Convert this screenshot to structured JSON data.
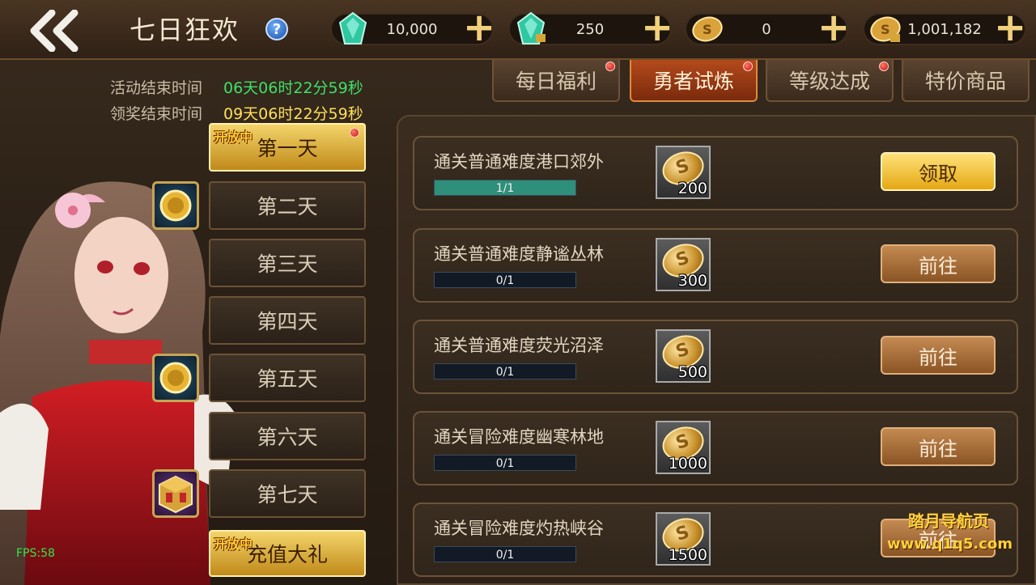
{
  "header": {
    "title": "七日狂欢",
    "help_symbol": "?",
    "back_symbol": "<<"
  },
  "resources": [
    {
      "icon": "green-gem-icon",
      "value": "10,000"
    },
    {
      "icon": "locked-gem-icon",
      "value": "250"
    },
    {
      "icon": "gold-coin-icon",
      "value": "0"
    },
    {
      "icon": "locked-coin-icon",
      "value": "1,001,182"
    }
  ],
  "plus_symbol": "+",
  "tabs": [
    {
      "label": "每日福利",
      "badge": true
    },
    {
      "label": "勇者试炼",
      "badge": true,
      "active": true
    },
    {
      "label": "等级达成",
      "badge": true
    },
    {
      "label": "特价商品",
      "badge": false
    }
  ],
  "timers": {
    "event_end_label": "活动结束时间",
    "event_end_value": "06天06时22分59秒",
    "claim_end_label": "领奖结束时间",
    "claim_end_value": "09天06时22分59秒"
  },
  "days": [
    {
      "label": "第一天",
      "open_tag": "开放中",
      "active": true
    },
    {
      "label": "第二天"
    },
    {
      "label": "第三天"
    },
    {
      "label": "第四天"
    },
    {
      "label": "第五天"
    },
    {
      "label": "第六天"
    },
    {
      "label": "第七天"
    },
    {
      "label": "充值大礼",
      "open_tag": "开放中",
      "active": true
    }
  ],
  "tasks": [
    {
      "title": "通关普通难度港口郊外",
      "progress": "1/1",
      "fraction": 1.0,
      "reward": "200",
      "button": "领取",
      "claimable": true
    },
    {
      "title": "通关普通难度静谧丛林",
      "progress": "0/1",
      "fraction": 0,
      "reward": "300",
      "button": "前往",
      "claimable": false
    },
    {
      "title": "通关普通难度荧光沼泽",
      "progress": "0/1",
      "fraction": 0,
      "reward": "500",
      "button": "前往",
      "claimable": false
    },
    {
      "title": "通关冒险难度幽寒林地",
      "progress": "0/1",
      "fraction": 0,
      "reward": "1000",
      "button": "前往",
      "claimable": false
    },
    {
      "title": "通关冒险难度灼热峡谷",
      "progress": "0/1",
      "fraction": 0,
      "reward": "1500",
      "button": "前往",
      "claimable": false
    }
  ],
  "fps": "FPS:58",
  "watermark": {
    "line1": "踏月导航页",
    "line2": "www.q1q5.com"
  },
  "colors": {
    "timer_event": "#3fe06a",
    "timer_claim": "#ffe05a"
  }
}
